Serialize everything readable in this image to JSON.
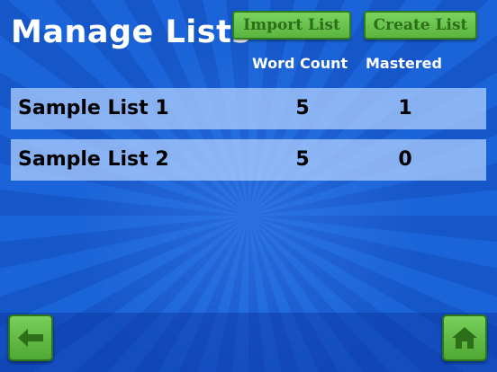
{
  "header": {
    "title": "Manage Lists",
    "import_label": "Import List",
    "create_label": "Create List"
  },
  "table": {
    "columns": [
      "Word Count",
      "Mastered"
    ],
    "rows": [
      {
        "name": "Sample List 1",
        "word_count": "5",
        "mastered": "1"
      },
      {
        "name": "Sample List 2",
        "word_count": "5",
        "mastered": "0"
      }
    ]
  },
  "nav": {
    "back_icon": "arrow-left-icon",
    "home_icon": "home-icon"
  },
  "colors": {
    "background": "#1a63d8",
    "button_green": "#6cc44e",
    "button_text": "#2c6f18",
    "row_bg": "#b4d2ff"
  }
}
